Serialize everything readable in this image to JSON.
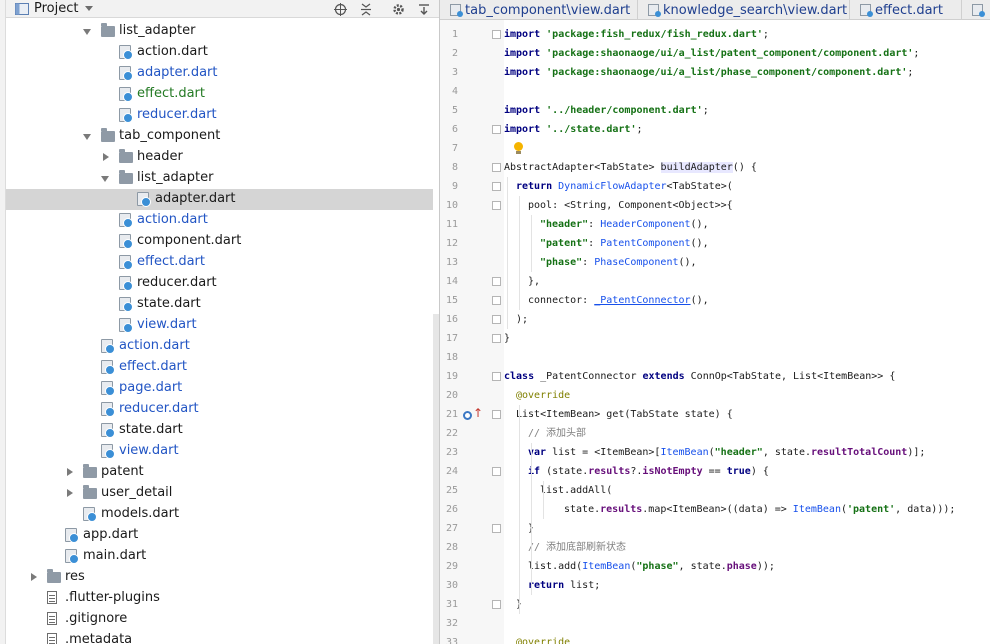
{
  "project_panel": {
    "title": "Project",
    "tree": [
      {
        "label": "list_adapter",
        "kind": "folder",
        "level": 4,
        "expanded": true,
        "color": "black"
      },
      {
        "label": "action.dart",
        "kind": "dart",
        "level": 5,
        "color": "black"
      },
      {
        "label": "adapter.dart",
        "kind": "dart",
        "level": 5,
        "color": "blue"
      },
      {
        "label": "effect.dart",
        "kind": "dart",
        "level": 5,
        "color": "green"
      },
      {
        "label": "reducer.dart",
        "kind": "dart",
        "level": 5,
        "color": "blue"
      },
      {
        "label": "tab_component",
        "kind": "folder",
        "level": 4,
        "expanded": true,
        "color": "black"
      },
      {
        "label": "header",
        "kind": "folder",
        "level": 5,
        "expanded": false,
        "color": "black"
      },
      {
        "label": "list_adapter",
        "kind": "folder",
        "level": 5,
        "expanded": true,
        "color": "black"
      },
      {
        "label": "adapter.dart",
        "kind": "dart",
        "level": 6,
        "color": "black",
        "selected": true
      },
      {
        "label": "action.dart",
        "kind": "dart",
        "level": 5,
        "color": "blue"
      },
      {
        "label": "component.dart",
        "kind": "dart",
        "level": 5,
        "color": "black"
      },
      {
        "label": "effect.dart",
        "kind": "dart",
        "level": 5,
        "color": "blue"
      },
      {
        "label": "reducer.dart",
        "kind": "dart",
        "level": 5,
        "color": "black"
      },
      {
        "label": "state.dart",
        "kind": "dart",
        "level": 5,
        "color": "black"
      },
      {
        "label": "view.dart",
        "kind": "dart",
        "level": 5,
        "color": "blue"
      },
      {
        "label": "action.dart",
        "kind": "dart",
        "level": 4,
        "color": "blue"
      },
      {
        "label": "effect.dart",
        "kind": "dart",
        "level": 4,
        "color": "blue"
      },
      {
        "label": "page.dart",
        "kind": "dart",
        "level": 4,
        "color": "blue"
      },
      {
        "label": "reducer.dart",
        "kind": "dart",
        "level": 4,
        "color": "blue"
      },
      {
        "label": "state.dart",
        "kind": "dart",
        "level": 4,
        "color": "black"
      },
      {
        "label": "view.dart",
        "kind": "dart",
        "level": 4,
        "color": "blue"
      },
      {
        "label": "patent",
        "kind": "folder",
        "level": 3,
        "expanded": false,
        "color": "black"
      },
      {
        "label": "user_detail",
        "kind": "folder",
        "level": 3,
        "expanded": false,
        "color": "black"
      },
      {
        "label": "models.dart",
        "kind": "dart",
        "level": 3,
        "color": "black"
      },
      {
        "label": "app.dart",
        "kind": "dart",
        "level": 2,
        "color": "black"
      },
      {
        "label": "main.dart",
        "kind": "dart",
        "level": 2,
        "color": "black"
      },
      {
        "label": "res",
        "kind": "folder",
        "level": 1,
        "expanded": false,
        "color": "black"
      },
      {
        "label": ".flutter-plugins",
        "kind": "file",
        "level": 1,
        "color": "black"
      },
      {
        "label": ".gitignore",
        "kind": "file",
        "level": 1,
        "color": "black"
      },
      {
        "label": ".metadata",
        "kind": "file",
        "level": 1,
        "color": "black"
      }
    ]
  },
  "editor": {
    "tabs": [
      {
        "label": "tab_component\\view.dart",
        "color": "blue"
      },
      {
        "label": "knowledge_search\\view.dart",
        "color": "blue"
      },
      {
        "label": "effect.dart",
        "color": "blue"
      }
    ],
    "lines": [
      {
        "n": "1",
        "indent": 0,
        "tokens": [
          [
            "kw",
            "import"
          ],
          [
            "pl",
            " "
          ],
          [
            "str",
            "'package:fish_redux/fish_redux.dart'"
          ],
          [
            "pl",
            ";"
          ]
        ]
      },
      {
        "n": "2",
        "indent": 0,
        "tokens": [
          [
            "kw",
            "import"
          ],
          [
            "pl",
            " "
          ],
          [
            "str",
            "'package:shaonaoge/ui/a_list/patent_component/component.dart'"
          ],
          [
            "pl",
            ";"
          ]
        ]
      },
      {
        "n": "3",
        "indent": 0,
        "tokens": [
          [
            "kw",
            "import"
          ],
          [
            "pl",
            " "
          ],
          [
            "str",
            "'package:shaonaoge/ui/a_list/phase_component/component.dart'"
          ],
          [
            "pl",
            ";"
          ]
        ]
      },
      {
        "n": "4",
        "indent": 0,
        "tokens": []
      },
      {
        "n": "5",
        "indent": 0,
        "tokens": [
          [
            "kw",
            "import"
          ],
          [
            "pl",
            " "
          ],
          [
            "str",
            "'../header/component.dart'"
          ],
          [
            "pl",
            ";"
          ]
        ]
      },
      {
        "n": "6",
        "indent": 0,
        "tokens": [
          [
            "kw",
            "import"
          ],
          [
            "pl",
            " "
          ],
          [
            "str",
            "'../state.dart'"
          ],
          [
            "pl",
            ";"
          ]
        ]
      },
      {
        "n": "7",
        "indent": 0,
        "tokens": []
      },
      {
        "n": "8",
        "indent": 0,
        "tokens": [
          [
            "pl",
            "AbstractAdapter<TabState> "
          ],
          [
            "hl",
            "buildAdapter"
          ],
          [
            "pl",
            "() {"
          ]
        ]
      },
      {
        "n": "9",
        "indent": 1,
        "tokens": [
          [
            "kw",
            "return"
          ],
          [
            "pl",
            " "
          ],
          [
            "ctor",
            "DynamicFlowAdapter"
          ],
          [
            "pl",
            "<TabState>("
          ]
        ]
      },
      {
        "n": "10",
        "indent": 2,
        "tokens": [
          [
            "pl",
            "pool: <String, Component<Object>>{"
          ]
        ]
      },
      {
        "n": "11",
        "indent": 3,
        "tokens": [
          [
            "str",
            "\"header\""
          ],
          [
            "pl",
            ": "
          ],
          [
            "ctor",
            "HeaderComponent"
          ],
          [
            "pl",
            "(),"
          ]
        ]
      },
      {
        "n": "12",
        "indent": 3,
        "tokens": [
          [
            "str",
            "\"patent\""
          ],
          [
            "pl",
            ": "
          ],
          [
            "ctor",
            "PatentComponent"
          ],
          [
            "pl",
            "(),"
          ]
        ]
      },
      {
        "n": "13",
        "indent": 3,
        "tokens": [
          [
            "str",
            "\"phase\""
          ],
          [
            "pl",
            ": "
          ],
          [
            "ctor",
            "PhaseComponent"
          ],
          [
            "pl",
            "(),"
          ]
        ]
      },
      {
        "n": "14",
        "indent": 2,
        "tokens": [
          [
            "pl",
            "},"
          ]
        ]
      },
      {
        "n": "15",
        "indent": 2,
        "tokens": [
          [
            "pl",
            "connector: "
          ],
          [
            "ctor-u",
            "_PatentConnector"
          ],
          [
            "pl",
            "(),"
          ]
        ]
      },
      {
        "n": "16",
        "indent": 1,
        "tokens": [
          [
            "pl",
            ");"
          ]
        ]
      },
      {
        "n": "17",
        "indent": 0,
        "tokens": [
          [
            "pl",
            "}"
          ]
        ]
      },
      {
        "n": "18",
        "indent": 0,
        "tokens": []
      },
      {
        "n": "19",
        "indent": 0,
        "tokens": [
          [
            "kw",
            "class"
          ],
          [
            "pl",
            " _PatentConnector "
          ],
          [
            "kw",
            "extends"
          ],
          [
            "pl",
            " ConnOp<TabState, List<ItemBean>> {"
          ]
        ]
      },
      {
        "n": "20",
        "indent": 1,
        "tokens": [
          [
            "an",
            "@override"
          ]
        ]
      },
      {
        "n": "21",
        "indent": 1,
        "tokens": [
          [
            "pl",
            "List<ItemBean> get(TabState state) {"
          ]
        ]
      },
      {
        "n": "22",
        "indent": 2,
        "tokens": [
          [
            "cm",
            "// 添加头部"
          ]
        ]
      },
      {
        "n": "23",
        "indent": 2,
        "tokens": [
          [
            "kw",
            "var"
          ],
          [
            "pl",
            " list = <ItemBean>["
          ],
          [
            "ctor",
            "ItemBean"
          ],
          [
            "pl",
            "("
          ],
          [
            "str",
            "\"header\""
          ],
          [
            "pl",
            ", state."
          ],
          [
            "fld",
            "resultTotalCount"
          ],
          [
            "pl",
            ")];"
          ]
        ]
      },
      {
        "n": "24",
        "indent": 2,
        "tokens": [
          [
            "kw",
            "if"
          ],
          [
            "pl",
            " (state."
          ],
          [
            "fld",
            "results"
          ],
          [
            "pl",
            "?."
          ],
          [
            "fld",
            "isNotEmpty"
          ],
          [
            "pl",
            " == "
          ],
          [
            "kw",
            "true"
          ],
          [
            "pl",
            ") {"
          ]
        ]
      },
      {
        "n": "25",
        "indent": 3,
        "tokens": [
          [
            "pl",
            "list.addAll("
          ]
        ]
      },
      {
        "n": "26",
        "indent": 5,
        "tokens": [
          [
            "pl",
            "state."
          ],
          [
            "fld",
            "results"
          ],
          [
            "pl",
            ".map<ItemBean>((data) => "
          ],
          [
            "ctor",
            "ItemBean"
          ],
          [
            "pl",
            "("
          ],
          [
            "str",
            "'patent'"
          ],
          [
            "pl",
            ", data)));"
          ]
        ]
      },
      {
        "n": "27",
        "indent": 2,
        "tokens": [
          [
            "pl",
            "}"
          ]
        ]
      },
      {
        "n": "28",
        "indent": 2,
        "tokens": [
          [
            "cm",
            "// 添加底部刷新状态"
          ]
        ]
      },
      {
        "n": "29",
        "indent": 2,
        "tokens": [
          [
            "pl",
            "list.add("
          ],
          [
            "ctor",
            "ItemBean"
          ],
          [
            "pl",
            "("
          ],
          [
            "str",
            "\"phase\""
          ],
          [
            "pl",
            ", state."
          ],
          [
            "fld",
            "phase"
          ],
          [
            "pl",
            "));"
          ]
        ]
      },
      {
        "n": "30",
        "indent": 2,
        "tokens": [
          [
            "kw",
            "return"
          ],
          [
            "pl",
            " list;"
          ]
        ]
      },
      {
        "n": "31",
        "indent": 1,
        "tokens": [
          [
            "pl",
            "}"
          ]
        ]
      },
      {
        "n": "32",
        "indent": 0,
        "tokens": []
      },
      {
        "n": "33",
        "indent": 1,
        "tokens": [
          [
            "an",
            "@override"
          ]
        ]
      }
    ],
    "fold_markers": [
      "1",
      "6",
      "8",
      "9",
      "10",
      "14",
      "15",
      "16",
      "17",
      "19",
      "21",
      "24",
      "27",
      "31"
    ]
  },
  "icons": {
    "project": "project-window-icon",
    "dropdown": "chevron-down-icon",
    "locate": "crosshair-icon",
    "collapse": "collapse-all-icon",
    "settings": "gear-icon",
    "hide": "hide-panel-icon",
    "bulb": "lightbulb-icon",
    "override": "override-marker-icon"
  },
  "colors": {
    "keyword": "#000080",
    "string": "#157115",
    "constructor": "#1750eb",
    "field": "#660e7a",
    "comment": "#808080",
    "annotation": "#808000",
    "selection": "#d5d5d5",
    "vcs_modified": "#2255c4",
    "vcs_added": "#247a24"
  }
}
